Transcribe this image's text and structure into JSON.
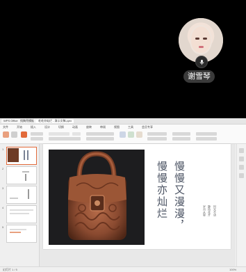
{
  "call": {
    "caller_name": "谢雪琴",
    "avatar": "user-avatar",
    "mic_icon": "microphone-icon"
  },
  "window": {
    "tabs": [
      "WPS Office",
      "找稿壳模板",
      "毛毛亦灿烂 - 演示文稿.pptx"
    ],
    "menu": [
      "文件",
      "开始",
      "插入",
      "设计",
      "切换",
      "动画",
      "放映",
      "审阅",
      "视图",
      "工具",
      "会员专享"
    ],
    "accent_color": "#e26a3a"
  },
  "slide": {
    "title_line1": "慢慢又漫漫，",
    "title_line2": "慢慢亦灿烂",
    "sub_line1": "时光不语",
    "sub_line2": "静待花开",
    "sub_line3": "岁月从容"
  },
  "thumbnails": [
    "1",
    "2",
    "3",
    "4",
    "5"
  ],
  "statusbar": {
    "left": "幻灯片 1 / 5",
    "right": "100%"
  }
}
